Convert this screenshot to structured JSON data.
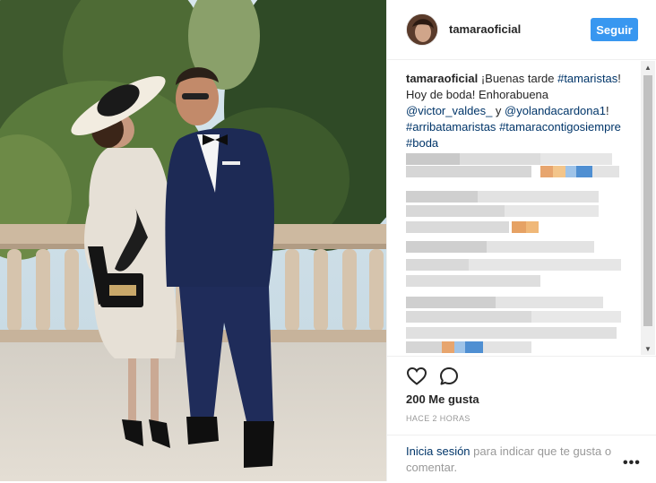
{
  "post": {
    "username": "tamaraoficial",
    "follow_label": "Seguir",
    "caption": {
      "username": "tamaraoficial",
      "text_1": " ¡Buenas tarde ",
      "hashtag_1": "#tamaristas",
      "text_2": "! Hoy de boda! Enhorabuena ",
      "mention_1": "@victor_valdes_",
      "text_3": " y ",
      "mention_2": "@yolandacardona1",
      "text_4": "! ",
      "hashtag_2": "#arribatamaristas",
      "text_5": " ",
      "hashtag_3": "#tamaracontigosiempre",
      "text_6": " ",
      "hashtag_4": "#boda"
    },
    "likes": "200 Me gusta",
    "timestamp": "HACE 2 HORAS",
    "login": {
      "link": "Inicia sesión",
      "text": " para indicar que te gusta o comentar."
    },
    "more_label": "•••"
  },
  "icons": {
    "like": "heart-outline-icon",
    "comment": "comment-bubble-icon",
    "more": "more-options-icon",
    "scroll_up": "scroll-up-arrow-icon",
    "scroll_down": "scroll-down-arrow-icon"
  },
  "colors": {
    "follow_button": "#3897f0",
    "link": "#003569",
    "muted": "#999999",
    "text": "#262626"
  }
}
